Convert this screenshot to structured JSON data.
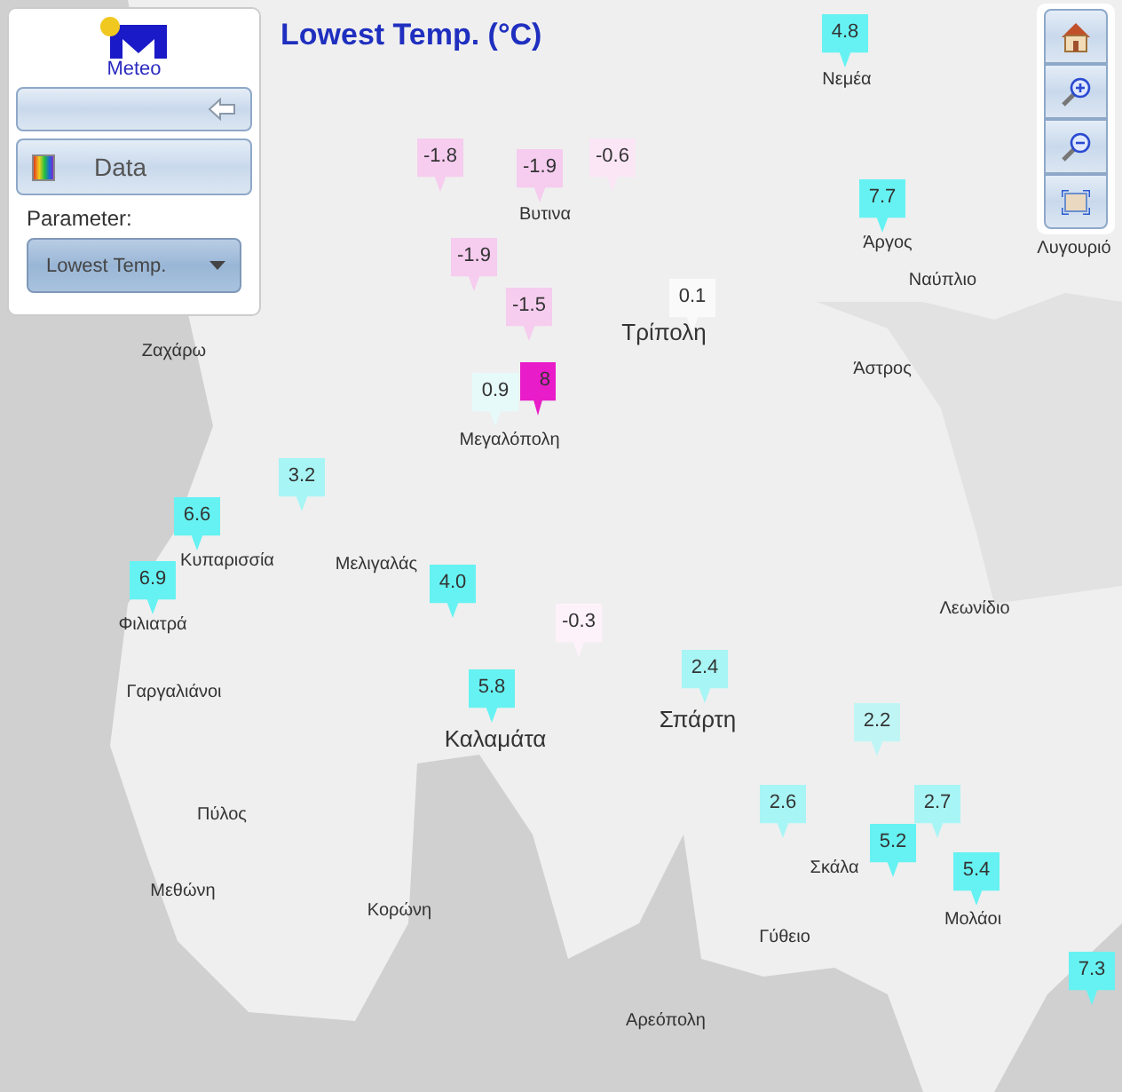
{
  "title": "Lowest Temp. (°C)",
  "panel": {
    "logo_text": "Meteo",
    "data_button": "Data",
    "parameter_label": "Parameter:",
    "parameter_select": "Lowest Temp."
  },
  "map_tools": [
    {
      "kind": "home"
    },
    {
      "kind": "zoom-in"
    },
    {
      "kind": "zoom-out"
    },
    {
      "kind": "extent"
    }
  ],
  "places": [
    "Νεμέα",
    "Άργος",
    "Ναύπλιο",
    "Λυγουριό",
    "Βυτινα",
    "Τρίπολη",
    "Μεγαλόπολη",
    "Ζαχάρω",
    "Άστρος",
    "Κυπαρισσία",
    "Μελιγαλάς",
    "Φιλιατρά",
    "Λεωνίδιο",
    "Γαργαλιάνοι",
    "Σπάρτη",
    "Καλαμάτα",
    "Πύλος",
    "Σκάλα",
    "Μεθώνη",
    "Μολάοι",
    "Κορώνη",
    "Γύθειο",
    "Αρεόπολη"
  ],
  "markers": [
    {
      "value": "4.8",
      "color": "#66f2f2"
    },
    {
      "value": "-1.8",
      "color": "#f6ccef"
    },
    {
      "value": "-1.9",
      "color": "#f6ccef"
    },
    {
      "value": "-0.6",
      "color": "#fbe6f6"
    },
    {
      "value": "7.7",
      "color": "#66f2f2"
    },
    {
      "value": "-1.9",
      "color": "#f6ccef"
    },
    {
      "value": "-1.5",
      "color": "#f6ccef"
    },
    {
      "value": "0.1",
      "color": "#fafafa"
    },
    {
      "value": "8",
      "color": "#e81cc8"
    },
    {
      "value": "0.9",
      "color": "#e6fafa"
    },
    {
      "value": "3.2",
      "color": "#a8f5f5"
    },
    {
      "value": "6.6",
      "color": "#66f2f2"
    },
    {
      "value": "6.9",
      "color": "#66f2f2"
    },
    {
      "value": "4.0",
      "color": "#66f2f2"
    },
    {
      "value": "-0.3",
      "color": "#fdf2fa"
    },
    {
      "value": "2.4",
      "color": "#a8f5f5"
    },
    {
      "value": "5.8",
      "color": "#66f2f2"
    },
    {
      "value": "2.2",
      "color": "#c0f5f5"
    },
    {
      "value": "2.6",
      "color": "#a8f5f5"
    },
    {
      "value": "2.7",
      "color": "#a8f5f5"
    },
    {
      "value": "5.2",
      "color": "#66f2f2"
    },
    {
      "value": "5.4",
      "color": "#66f2f2"
    },
    {
      "value": "7.3",
      "color": "#66f2f2"
    }
  ]
}
